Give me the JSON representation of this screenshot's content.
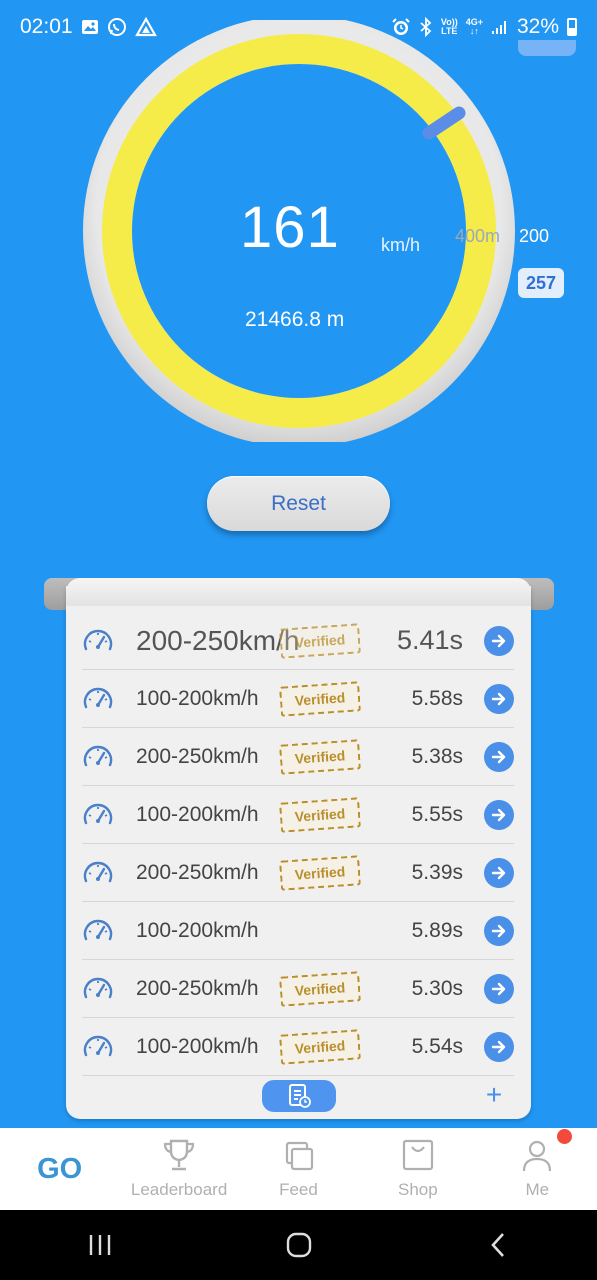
{
  "status_bar": {
    "time": "02:01",
    "battery": "32%",
    "network_top": "Vo))",
    "network_bottom": "LTE",
    "network_4g": "4G+"
  },
  "gauge": {
    "speed": "161",
    "unit": "km/h",
    "distance_label": "400m",
    "distance": "21466.8 m",
    "target_speed": "200",
    "max_speed": "257",
    "ring_color": "#F5EC4A",
    "needle_color": "#5B8DE8"
  },
  "reset_label": "Reset",
  "records": [
    {
      "range": "200-250km/h",
      "verified": true,
      "time": "5.41s"
    },
    {
      "range": "100-200km/h",
      "verified": true,
      "time": "5.58s"
    },
    {
      "range": "200-250km/h",
      "verified": true,
      "time": "5.38s"
    },
    {
      "range": "100-200km/h",
      "verified": true,
      "time": "5.55s"
    },
    {
      "range": "200-250km/h",
      "verified": true,
      "time": "5.39s"
    },
    {
      "range": "100-200km/h",
      "verified": false,
      "time": "5.89s"
    },
    {
      "range": "200-250km/h",
      "verified": true,
      "time": "5.30s"
    },
    {
      "range": "100-200km/h",
      "verified": true,
      "time": "5.54s"
    }
  ],
  "verified_label": "Verified",
  "add_label": "+",
  "nav": {
    "go": "GO",
    "leaderboard": "Leaderboard",
    "feed": "Feed",
    "shop": "Shop",
    "me": "Me"
  },
  "colors": {
    "background": "#2196F3",
    "accent": "#4A90E8",
    "stamp": "#B98F2C",
    "notification": "#F24B3D"
  }
}
